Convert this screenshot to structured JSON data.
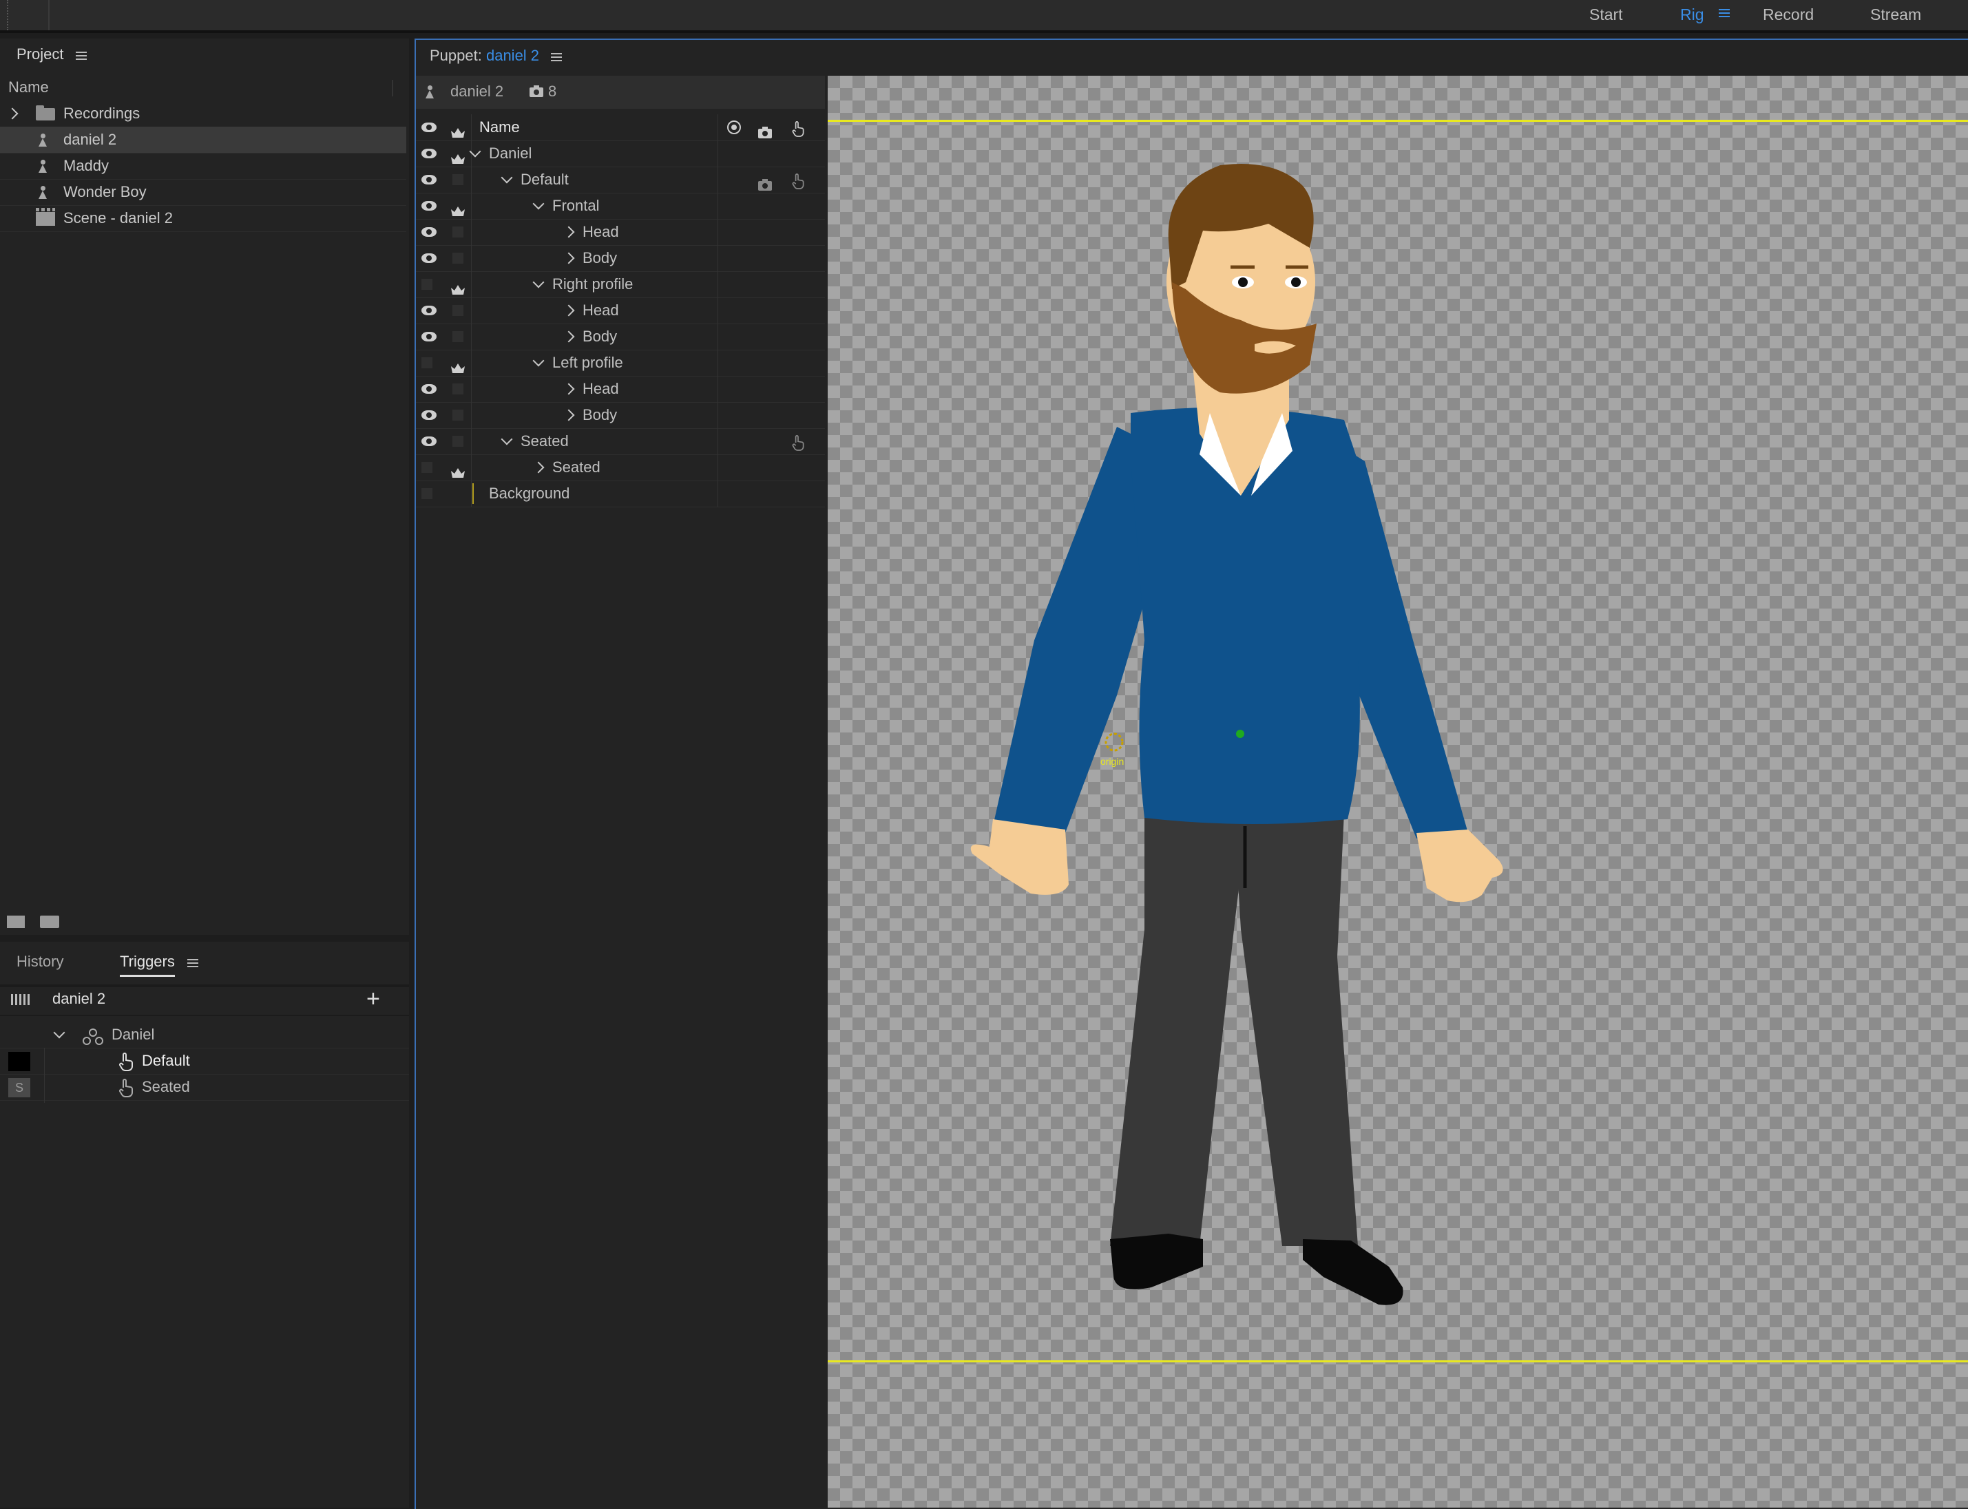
{
  "workspace_tabs": [
    "Start",
    "Rig",
    "Record",
    "Stream"
  ],
  "active_workspace": "Rig",
  "project": {
    "title": "Project",
    "column_header": "Name",
    "items": [
      {
        "label": "Recordings",
        "type": "folder"
      },
      {
        "label": "daniel 2",
        "type": "puppet",
        "selected": true
      },
      {
        "label": "Maddy",
        "type": "puppet"
      },
      {
        "label": "Wonder Boy",
        "type": "puppet"
      },
      {
        "label": "Scene - daniel 2",
        "type": "scene"
      }
    ]
  },
  "bottom_panel": {
    "tabs": [
      "History",
      "Triggers"
    ],
    "active_tab": "Triggers",
    "puppet_name": "daniel 2",
    "group": "Daniel",
    "triggers": [
      {
        "label": "Default",
        "key": ""
      },
      {
        "label": "Seated",
        "key": "S"
      }
    ]
  },
  "puppet_panel": {
    "title_prefix": "Puppet:",
    "puppet_name": "daniel 2",
    "header_name": "daniel 2",
    "camera_count": "8",
    "name_column": "Name",
    "layers": [
      {
        "label": "Daniel"
      },
      {
        "label": "Default"
      },
      {
        "label": "Frontal"
      },
      {
        "label": "Head"
      },
      {
        "label": "Body"
      },
      {
        "label": "Right profile"
      },
      {
        "label": "Head"
      },
      {
        "label": "Body"
      },
      {
        "label": "Left profile"
      },
      {
        "label": "Head"
      },
      {
        "label": "Body"
      },
      {
        "label": "Seated"
      },
      {
        "label": "Seated"
      },
      {
        "label": "Background"
      }
    ]
  },
  "canvas": {
    "origin_label": "origin"
  },
  "colors": {
    "accent": "#3a8ee6",
    "guide_line": "#e8e820",
    "sweater": "#0f528c",
    "pants": "#383838",
    "skin": "#f5cc95",
    "hair": "#6e4414"
  }
}
